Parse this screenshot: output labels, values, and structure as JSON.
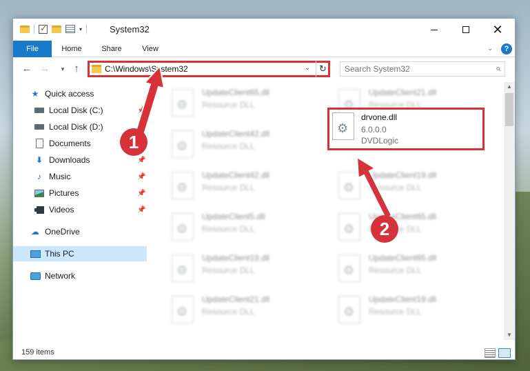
{
  "window": {
    "title": "System32",
    "controls": {
      "minimize": "",
      "maximize": "",
      "close": "✕"
    }
  },
  "ribbon": {
    "tabs": [
      "File",
      "Home",
      "Share",
      "View"
    ],
    "help": "?"
  },
  "nav": {
    "back": "←",
    "forward": "→",
    "recent": "▾",
    "up": "↑",
    "address": "C:\\Windows\\System32",
    "search_placeholder": "Search System32"
  },
  "sidebar": {
    "items": [
      {
        "label": "Quick access",
        "icon": "star-icon",
        "pinned": false
      },
      {
        "label": "Local Disk (C:)",
        "icon": "disk-icon",
        "pinned": true
      },
      {
        "label": "Local Disk (D:)",
        "icon": "disk-icon",
        "pinned": true
      },
      {
        "label": "Documents",
        "icon": "documents-icon",
        "pinned": true
      },
      {
        "label": "Downloads",
        "icon": "download-icon",
        "pinned": true
      },
      {
        "label": "Music",
        "icon": "music-icon",
        "pinned": true
      },
      {
        "label": "Pictures",
        "icon": "pictures-icon",
        "pinned": true
      },
      {
        "label": "Videos",
        "icon": "videos-icon",
        "pinned": true
      },
      {
        "label": "OneDrive",
        "icon": "cloud-icon",
        "pinned": false
      },
      {
        "label": "This PC",
        "icon": "pc-icon",
        "pinned": false,
        "selected": true
      },
      {
        "label": "Network",
        "icon": "network-icon",
        "pinned": false
      }
    ]
  },
  "files": {
    "left": [
      {
        "name": "UpdateClient65.dll",
        "type": "Resource DLL"
      },
      {
        "name": "UpdateClient42.dll",
        "type": "Resource DLL"
      },
      {
        "name": "UpdateClient42.dll",
        "type": "Resource DLL"
      },
      {
        "name": "UpdateClient5.dll",
        "type": "Resource DLL"
      },
      {
        "name": "UpdateClient19.dll",
        "type": "Resource DLL"
      },
      {
        "name": "UpdateClient21.dll",
        "type": "Resource DLL"
      }
    ],
    "right": [
      {
        "name": "UpdateClient21.dll",
        "type": "Resource DLL"
      },
      {
        "name": "UpdateClient19.dll",
        "type": "Resource DLL"
      },
      {
        "name": "UpdateClient65.dll",
        "type": "Resource DLL"
      },
      {
        "name": "UpdateClient65.dll",
        "type": "Resource DLL"
      },
      {
        "name": "UpdateClient19.dll",
        "type": "Resource DLL"
      }
    ],
    "focused": {
      "name": "drvone.dll",
      "version": "6.0.0.0",
      "company": "DVDLogic"
    }
  },
  "status": {
    "item_count": "159 items"
  },
  "callouts": {
    "step1": "1",
    "step2": "2",
    "color": "#d6323a"
  }
}
